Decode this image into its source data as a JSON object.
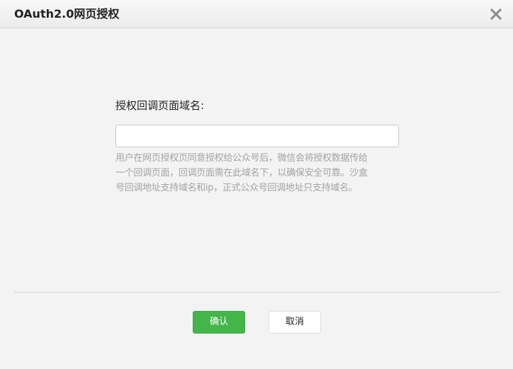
{
  "dialog": {
    "title": "OAuth2.0网页授权",
    "close_icon": "close-icon"
  },
  "form": {
    "label": "授权回调页面域名:",
    "input_value": "",
    "input_placeholder": "",
    "tips": [
      "用户在网页授权页同意授权给公众号后，微信会将授权数据传给",
      "一个回调页面，回调页面需在此域名下，以确保安全可靠。沙盒",
      "号回调地址支持域名和ip，正式公众号回调地址只支持域名。"
    ]
  },
  "buttons": {
    "confirm_label": "确认",
    "cancel_label": "取消"
  },
  "colors": {
    "confirm_bg": "#44b549",
    "tips_text": "#a3a3a3"
  }
}
